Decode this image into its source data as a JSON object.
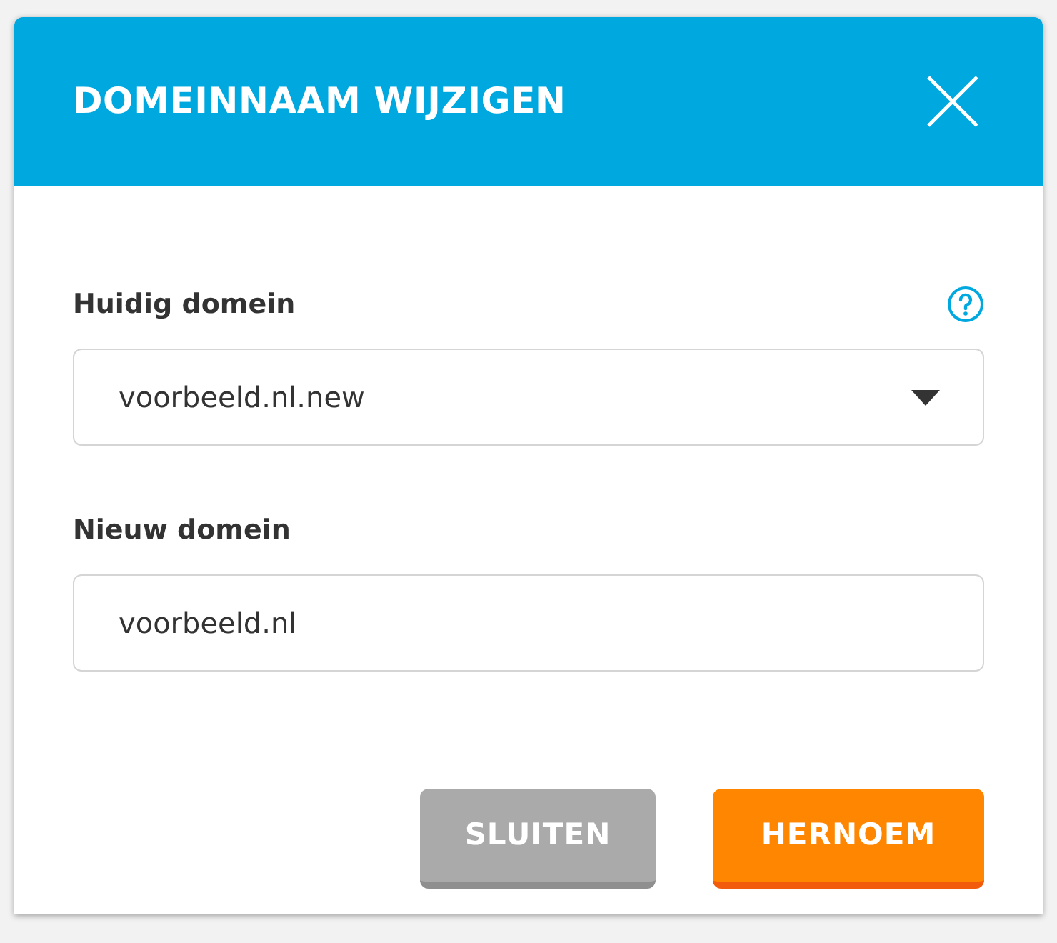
{
  "dialog": {
    "title": "DOMEINNAAM WIJZIGEN",
    "fields": [
      {
        "kind": "select",
        "label": "Huidig domein",
        "value": "voorbeeld.nl.new",
        "help": true
      },
      {
        "kind": "input",
        "label": "Nieuw domein",
        "value": "voorbeeld.nl",
        "help": false
      }
    ],
    "buttons": [
      {
        "kind": "secondary",
        "label": "SLUITEN"
      },
      {
        "kind": "primary",
        "label": "HERNOEM"
      }
    ]
  }
}
